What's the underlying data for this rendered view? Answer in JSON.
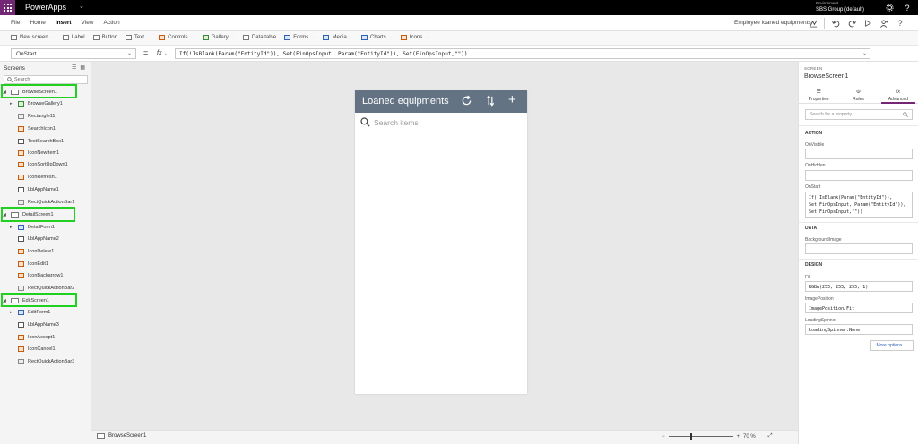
{
  "topbar": {
    "app_name": "PowerApps",
    "environment_label": "Environment",
    "environment_name": "SBS Group (default)"
  },
  "menubar": {
    "items": [
      "File",
      "Home",
      "Insert",
      "View",
      "Action"
    ],
    "active": "Insert",
    "document_name": "Employee loaned equipments"
  },
  "toolbar": {
    "new_screen": "New screen",
    "label": "Label",
    "button": "Button",
    "text": "Text",
    "controls": "Controls",
    "gallery": "Gallery",
    "data_table": "Data table",
    "forms": "Forms",
    "media": "Media",
    "charts": "Charts",
    "icons": "Icons"
  },
  "formula_bar": {
    "property": "OnStart",
    "equals": "=",
    "fx": "fx",
    "formula": "If(!IsBlank(Param(\"EntityId\")), Set(FinOpsInput, Param(\"EntityId\")), Set(FinOpsInput,\"\"))"
  },
  "left_pane": {
    "title": "Screens",
    "search_placeholder": "Search",
    "items": {
      "browse_screen": "BrowseScreen1",
      "browse_gallery": "BrowseGallery1",
      "rectangle": "Rectangle11",
      "search_icon": "SearchIcon1",
      "text_search": "TextSearchBox1",
      "icon_new": "IconNewItem1",
      "icon_sort": "IconSortUpDown1",
      "icon_refresh": "IconRefresh1",
      "lbl_app_name1": "LblAppName1",
      "rect_quick1": "RectQuickActionBar1",
      "detail_screen": "DetailScreen1",
      "detail_form": "DetailForm1",
      "lbl_app_name2": "LblAppName2",
      "icon_delete": "IconDelete1",
      "icon_edit": "IconEdit1",
      "icon_backarrow": "IconBackarrow1",
      "rect_quick2": "RectQuickActionBar2",
      "edit_screen": "EditScreen1",
      "edit_form": "EditForm1",
      "lbl_app_name3": "LblAppName3",
      "icon_accept": "IconAccept1",
      "icon_cancel": "IconCancel1",
      "rect_quick3": "RectQuickActionBar3"
    }
  },
  "phone": {
    "title": "Loaned equipments",
    "search_placeholder": "Search items"
  },
  "status_bar": {
    "screen": "BrowseScreen1",
    "zoom_minus": "−",
    "zoom_plus": "+",
    "zoom": "70 %"
  },
  "right_pane": {
    "label": "SCREEN",
    "name": "BrowseScreen1",
    "tabs": [
      "Properties",
      "Rules",
      "Advanced"
    ],
    "active_tab": "Advanced",
    "search_placeholder": "Search for a property ...",
    "sections": {
      "action": "ACTION",
      "data": "DATA",
      "design": "DESIGN"
    },
    "props": {
      "onvisible_label": "OnVisible",
      "onvisible_value": "",
      "onhidden_label": "OnHidden",
      "onhidden_value": "",
      "onstart_label": "OnStart",
      "onstart_value": "If(!IsBlank(Param(\"EntityId\")), Set(FinOpsInput, Param(\"EntityId\")), Set(FinOpsInput,\"\"))",
      "bgimage_label": "BackgroundImage",
      "bgimage_value": "",
      "fill_label": "Fill",
      "fill_value": "RGBA(255, 255, 255, 1)",
      "imagepos_label": "ImagePosition",
      "imagepos_value": "ImagePosition.Fit",
      "spinner_label": "LoadingSpinner",
      "spinner_value": "LoadingSpinner.None"
    },
    "more_options": "More options"
  },
  "colors": {
    "brand": "#742774",
    "phone_header": "#637384",
    "highlight": "#21d121"
  }
}
